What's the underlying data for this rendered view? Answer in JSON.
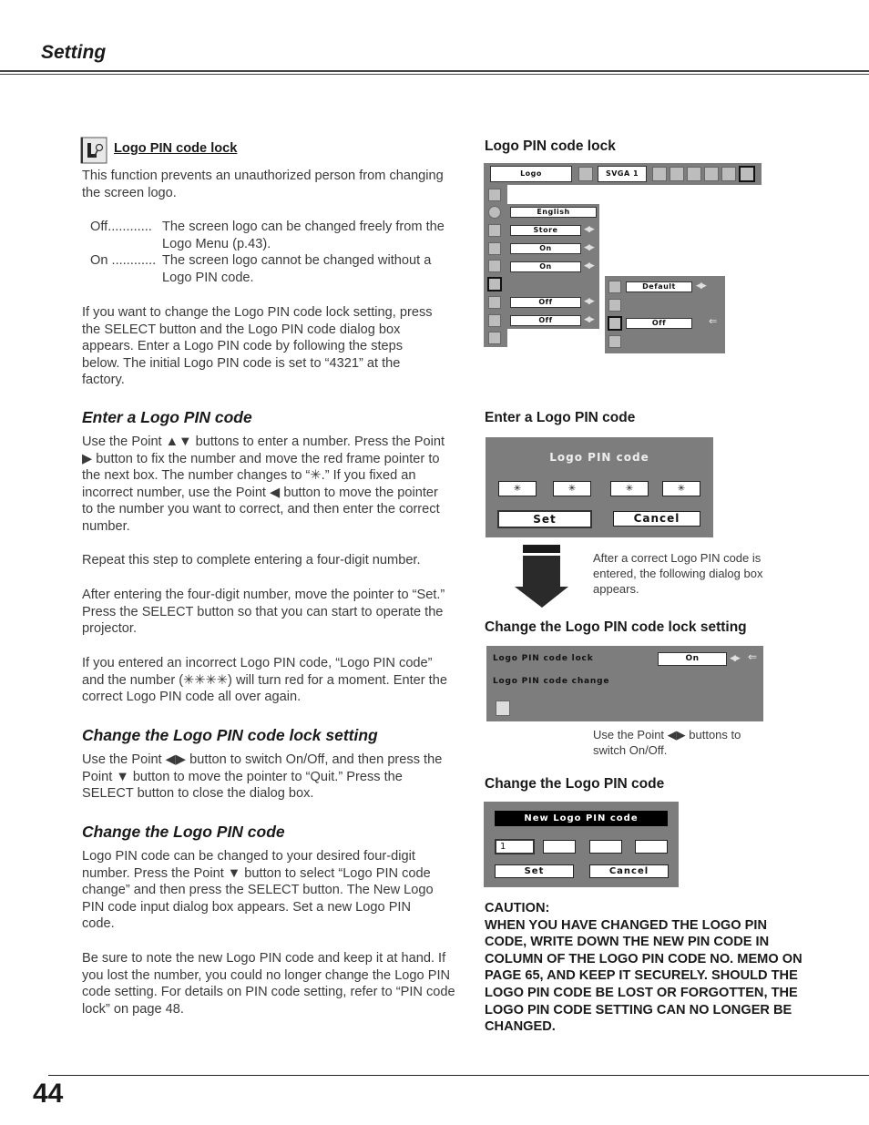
{
  "header": {
    "title": "Setting"
  },
  "footer": {
    "page_number": "44"
  },
  "intro": {
    "title": "Logo PIN code lock",
    "icon": "logo-pin-lock-icon",
    "paragraph": "This function prevents an unauthorized person from changing the screen logo.",
    "options": [
      {
        "term": "Off............",
        "desc": "The screen logo can be changed freely from the Logo Menu (p.43)."
      },
      {
        "term": "On ............",
        "desc": "The screen logo cannot be changed without a Logo PIN code."
      }
    ],
    "paragraph2": "If you want to change the Logo PIN code lock setting, press the SELECT button and the Logo PIN code dialog box appears. Enter a Logo PIN code by following the steps below. The initial Logo PIN code is set to “4321” at the factory."
  },
  "sections": {
    "enter": {
      "heading": "Enter a Logo PIN code",
      "p1": "Use the Point ▲▼ buttons to enter a number. Press the Point ▶ button to fix the number and move the red frame pointer to the next box. The number changes to “✳.” If you fixed an incorrect number, use the Point ◀ button to move the pointer to the number you want to correct, and then enter the correct number.",
      "p2": "Repeat this step to complete entering a four-digit number.",
      "p3": "After entering the four-digit number, move the pointer to “Set.” Press the SELECT button so that you can start to operate the projector.",
      "p4": "If you entered an incorrect Logo PIN code, “Logo PIN code” and the number (✳✳✳✳) will turn red for a moment. Enter the correct Logo PIN code all over again."
    },
    "lock_setting": {
      "heading": "Change the Logo PIN code lock setting",
      "p1": "Use the Point ◀▶ button to switch On/Off, and then press the Point ▼ button to move the pointer to “Quit.” Press the SELECT button to close the dialog box."
    },
    "change_code": {
      "heading": "Change the Logo PIN code",
      "p1": "Logo PIN code can be changed to your desired four-digit number. Press the Point ▼ button to select “Logo PIN code change” and then press the SELECT button. The New Logo PIN code input dialog box appears. Set a new Logo PIN code.",
      "p2": "Be sure to note the new Logo PIN code and keep it at hand. If you lost the number, you could no longer change the Logo PIN code setting. For details on PIN code setting, refer to “PIN code lock” on page 48."
    }
  },
  "figures": {
    "menu": {
      "heading": "Logo PIN code lock",
      "top_bar": {
        "menu_name": "Logo",
        "source": "SVGA 1"
      },
      "setting_values": [
        "English",
        "Store",
        "On",
        "On",
        "Off",
        "Off"
      ],
      "logo_submenu": {
        "logo_select": "Default",
        "logo_pin_lock": "Off"
      }
    },
    "pin_dialog": {
      "heading": "Enter a Logo PIN code",
      "title": "Logo PIN code",
      "digits": [
        "✳",
        "✳",
        "✳",
        "✳"
      ],
      "set_label": "Set",
      "cancel_label": "Cancel",
      "arrow_caption": "After a correct Logo PIN code is entered, the following dialog box appears."
    },
    "lock_setting_dialog": {
      "heading": "Change the Logo PIN code lock setting",
      "row1_label": "Logo PIN code lock",
      "row1_value": "On",
      "row2_label": "Logo PIN code change",
      "caption": "Use the Point ◀▶ buttons to switch On/Off."
    },
    "new_pin_dialog": {
      "heading": "Change the Logo PIN code",
      "title": "New Logo PIN code",
      "digits": [
        "1",
        "",
        "",
        ""
      ],
      "set_label": "Set",
      "cancel_label": "Cancel"
    }
  },
  "caution": {
    "title": "CAUTION:",
    "text": "WHEN YOU HAVE CHANGED THE LOGO PIN CODE, WRITE DOWN THE NEW PIN CODE IN COLUMN OF THE LOGO PIN CODE NO. MEMO ON PAGE 65, AND KEEP IT SECURELY. SHOULD THE LOGO PIN CODE BE LOST OR FORGOTTEN, THE LOGO PIN CODE SETTING CAN NO LONGER BE CHANGED."
  }
}
